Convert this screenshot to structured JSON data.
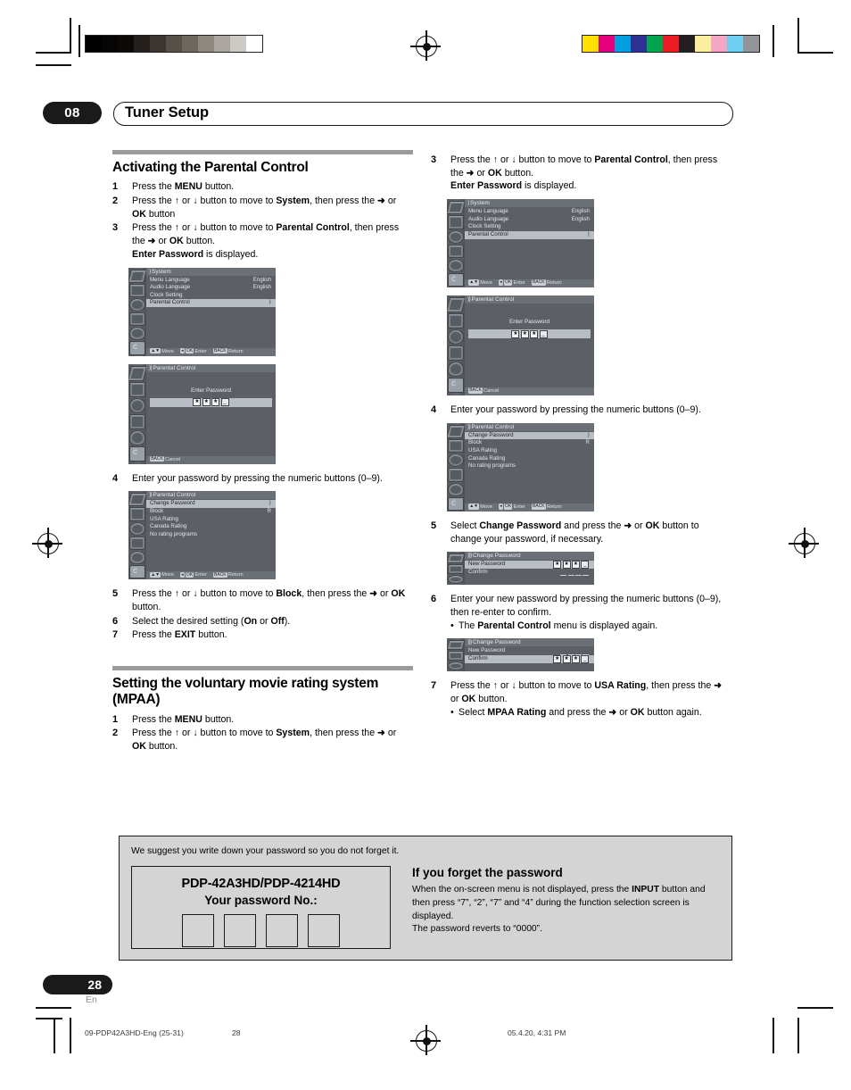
{
  "header": {
    "chapter": "08",
    "title": "Tuner Setup"
  },
  "footer": {
    "page_number": "28",
    "language_code": "En",
    "running_file": "09-PDP42A3HD-Eng (25-31)",
    "running_page": "28",
    "running_date": "05.4.20, 4:31 PM"
  },
  "left_column": {
    "section1": {
      "title": "Activating the Parental Control",
      "steps": [
        {
          "num": "1",
          "html": "Press the <b>MENU</b> button."
        },
        {
          "num": "2",
          "html": "Press the <b>↑</b> or <b>↓</b> button to move to <b>System</b>, then press the <b>➜</b> or <b>OK</b> button"
        },
        {
          "num": "3",
          "html": "Press the <b>↑</b> or <b>↓</b> button to move to <b>Parental Control</b>, then press the <b>➜</b> or <b>OK</b> button.<br><b>Enter Password</b> is displayed."
        },
        {
          "num": "4",
          "html": "Enter your password by pressing the numeric buttons (0–9)."
        },
        {
          "num": "5",
          "html": "Press the <b>↑</b> or <b>↓</b> button to move to <b>Block</b>, then press the <b>➜</b> or <b>OK</b> button."
        },
        {
          "num": "6",
          "html": "Select the desired setting (<b>On</b> or <b>Off</b>)."
        },
        {
          "num": "7",
          "html": "Press the <b>EXIT</b> button."
        }
      ]
    },
    "section2": {
      "title": "Setting the voluntary movie rating system (MPAA)",
      "steps": [
        {
          "num": "1",
          "html": "Press the <b>MENU</b> button."
        },
        {
          "num": "2",
          "html": "Press the <b>↑</b> or <b>↓</b> button to move to <b>System</b>, then press the <b>➜</b> or <b>OK</b> button."
        }
      ]
    }
  },
  "right_column": {
    "steps": [
      {
        "num": "3",
        "html": "Press the <b>↑</b> or <b>↓</b> button to move to <b>Parental Control</b>, then press the <b>➜</b> or <b>OK</b> button.<br><b>Enter Password</b> is displayed."
      },
      {
        "num": "4",
        "html": "Enter your password by pressing the numeric buttons (0–9)."
      },
      {
        "num": "5",
        "html": "Select <b>Change Password</b> and press the <b>➜</b> or <b>OK</b> button to change your password, if necessary."
      },
      {
        "num": "6",
        "html": "Enter your new password by pressing the numeric buttons (0–9), then re-enter to confirm."
      },
      {
        "num": "7",
        "html": "Press the <b>↑</b> or <b>↓</b> button to move to <b>USA Rating</b>, then press the <b>➜</b> or <b>OK</b> button."
      }
    ],
    "step6_sub": "The <b>Parental Control</b> menu is displayed again.",
    "step7_sub": "Select <b>MPAA Rating</b> and press the <b>➜</b> or <b>OK</b> button again."
  },
  "osd": {
    "system_menu": {
      "title": "System",
      "chevrons": "⟩",
      "rows": [
        {
          "label": "Menu Language",
          "value": "English",
          "selected": false
        },
        {
          "label": "Audio Language",
          "value": "English",
          "selected": false
        },
        {
          "label": "Clock Setting",
          "value": "",
          "selected": false
        },
        {
          "label": "Parental Control",
          "value": "⟩",
          "selected": true
        }
      ],
      "footer": {
        "move": "Move",
        "enter": "Enter",
        "return": "Return",
        "enter_key": "OK",
        "return_key": "BACK"
      }
    },
    "enter_password": {
      "title": "Parental Control",
      "chevrons": "⟩⟩",
      "prompt": "Enter Password",
      "entered": [
        "★",
        "★",
        "★"
      ],
      "cursor": "_",
      "footer": {
        "cancel": "Cancel",
        "cancel_key": "BACK"
      }
    },
    "parental_control": {
      "title": "Parental Control",
      "chevrons": "⟩⟩",
      "rows": [
        {
          "label": "Change Password",
          "value": "⟩",
          "selected": true
        },
        {
          "label": "Block",
          "value": "R",
          "selected": false
        },
        {
          "label": "USA Rating",
          "value": "",
          "selected": false
        },
        {
          "label": "Canada Rating",
          "value": "",
          "selected": false
        },
        {
          "label": "No rating programs",
          "value": "",
          "selected": false
        }
      ],
      "footer": {
        "move": "Move",
        "enter": "Enter",
        "return": "Return",
        "enter_key": "OK",
        "return_key": "BACK"
      }
    },
    "change_password_new": {
      "title": "Change Password",
      "chevrons": "⟩⟩⟩",
      "rows": [
        {
          "label": "New Password",
          "value": "★★★_",
          "selected": true
        },
        {
          "label": "Confirm",
          "value": "____",
          "selected": false
        }
      ]
    },
    "change_password_confirm": {
      "title": "Change Password",
      "chevrons": "⟩⟩⟩",
      "rows": [
        {
          "label": "New Password",
          "value": "____",
          "selected": false
        },
        {
          "label": "Confirm",
          "value": "★★★_",
          "selected": true
        }
      ]
    }
  },
  "note": {
    "intro": "We suggest you write down your password so you do not forget it.",
    "card": {
      "model": "PDP-42A3HD/PDP-4214HD",
      "label": "Your password No.:",
      "digit_boxes": 4
    },
    "forget_title": "If you forget the password",
    "forget_body": "When the on-screen menu is not displayed, press the INPUT button and then press “7”, “2”, “7” and “4” during the function selection screen is displayed. The password reverts to “0000”."
  },
  "print_marks": {
    "gray_swatches": [
      "#000000",
      "#060404",
      "#0d0906",
      "#241f1c",
      "#3b342f",
      "#565049",
      "#6e6760",
      "#8d8780",
      "#aba59f",
      "#cdc9c4",
      "#ffffff"
    ],
    "color_swatches": [
      "#ffe000",
      "#e6007e",
      "#00a0e0",
      "#2e3192",
      "#00a550",
      "#ed1c24",
      "#231f20",
      "#fbeea0",
      "#f4a7c4",
      "#6fcff0",
      "#939598"
    ]
  }
}
